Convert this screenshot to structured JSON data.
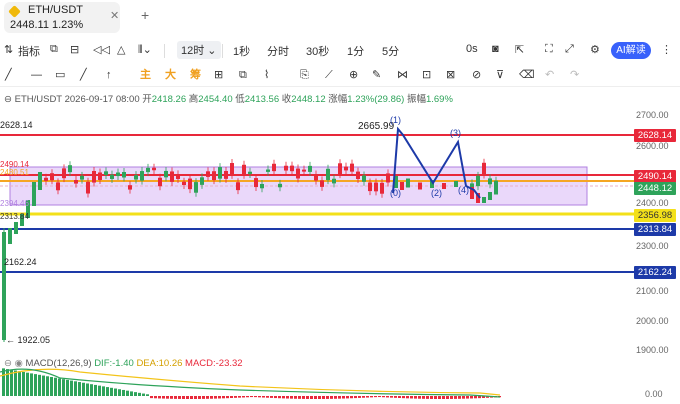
{
  "tab": {
    "symbol": "ETH/USDT",
    "price_line": "2448.11  1.23%",
    "close_icon": "close-icon"
  },
  "toolbar1": {
    "indicators": "指标",
    "interval": "12时",
    "i1": "1秒",
    "i2": "分时",
    "i3": "30秒",
    "i4": "1分",
    "i5": "5分",
    "zero_s": "0s",
    "ai_label": "AI解读"
  },
  "toolbar2": {
    "t_zhu": "主",
    "t_da": "大",
    "t_chou": "筹"
  },
  "info": {
    "symbol": "ETH/USDT",
    "datetime": "2026-09-17 08:00",
    "open_label": "开",
    "open": "2418.26",
    "high_label": "高",
    "high": "2454.40",
    "low_label": "低",
    "low": "2413.56",
    "close_label": "收",
    "close": "2448.12",
    "chg_label": "涨幅",
    "chg": "1.23%(29.86)",
    "amp_label": "振幅",
    "amp": "1.69%"
  },
  "axis": {
    "ticks": [
      "2700.00",
      "2600.00",
      "2400.00",
      "2300.00",
      "2100.00",
      "2000.00",
      "1900.00",
      "0.00"
    ]
  },
  "price_badges": {
    "b1": "2628.14",
    "b2": "2490.14",
    "b3": "2448.12",
    "b4": "2356.98",
    "b5": "2313.84",
    "b6": "2162.24"
  },
  "annotations": {
    "left_2628": "2628.14",
    "left_2490": "2490.14",
    "left_2480": "2480.51",
    "left_2394": "2394.46",
    "left_2313": "2313.84",
    "left_2162": "2162.24",
    "low": "1922.05",
    "peak": "2665.99",
    "w1": "(1)",
    "w2": "(2)",
    "w3": "(3)",
    "w4": "(4)",
    "w0": "(0)"
  },
  "macd": {
    "name": "MACD(12,26,9)",
    "dif": "DIF:-1.40",
    "dea": "DEA:10.26",
    "macd": "MACD:-23.32"
  },
  "colors": {
    "red": "#e8283a",
    "blue": "#1d3aa8",
    "yellow": "#f3e01a",
    "orange": "#f5a623",
    "green": "#2ea35a",
    "purple_box": "#c9a0f0",
    "ai_blue": "#3861fb"
  }
}
